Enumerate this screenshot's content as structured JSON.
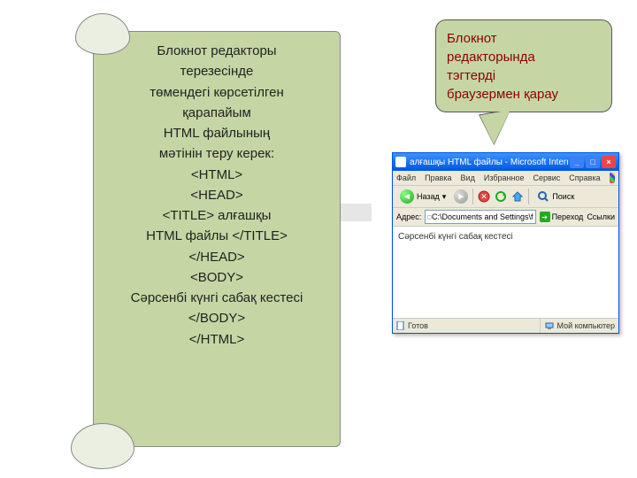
{
  "scroll": {
    "l1": "Блокнот редакторы",
    "l2": "терезесінде",
    "l3": "төмендегі көрсетілген",
    "l4": "қарапайым",
    "l5": "HTML файлының",
    "l6": "мәтінін теру керек:",
    "l7": "<HTML>",
    "l8": "<HEAD>",
    "l9": "<TITLE> алғашқы",
    "l10": "HTML файлы </TITLE>",
    "l11": "</HEAD>",
    "l12": "<BODY>",
    "l13": "Сәрсенбі күнгі сабақ кестесі",
    "l14": "</BODY>",
    "l15": "</HTML>"
  },
  "callout": {
    "l1": "Блокнот",
    "l2": "редакторында",
    "l3": "тэгтерді",
    "l4": "браузермен қарау"
  },
  "browser": {
    "title": "алғашқы HTML файлы - Microsoft Internet ...",
    "menu": {
      "file": "Файл",
      "edit": "Правка",
      "view": "Вид",
      "fav": "Избранное",
      "tools": "Сервис",
      "help": "Справка"
    },
    "toolbar": {
      "back": "Назад",
      "search": "Поиск"
    },
    "address": {
      "label": "Адрес:",
      "value": "C:\\Documents and Settings\\f",
      "go": "Переход",
      "links": "Ссылки"
    },
    "content": "Сәрсенбі күнгі сабақ кестесі",
    "status": {
      "ready": "Готов",
      "zone": "Мой компьютер"
    }
  }
}
